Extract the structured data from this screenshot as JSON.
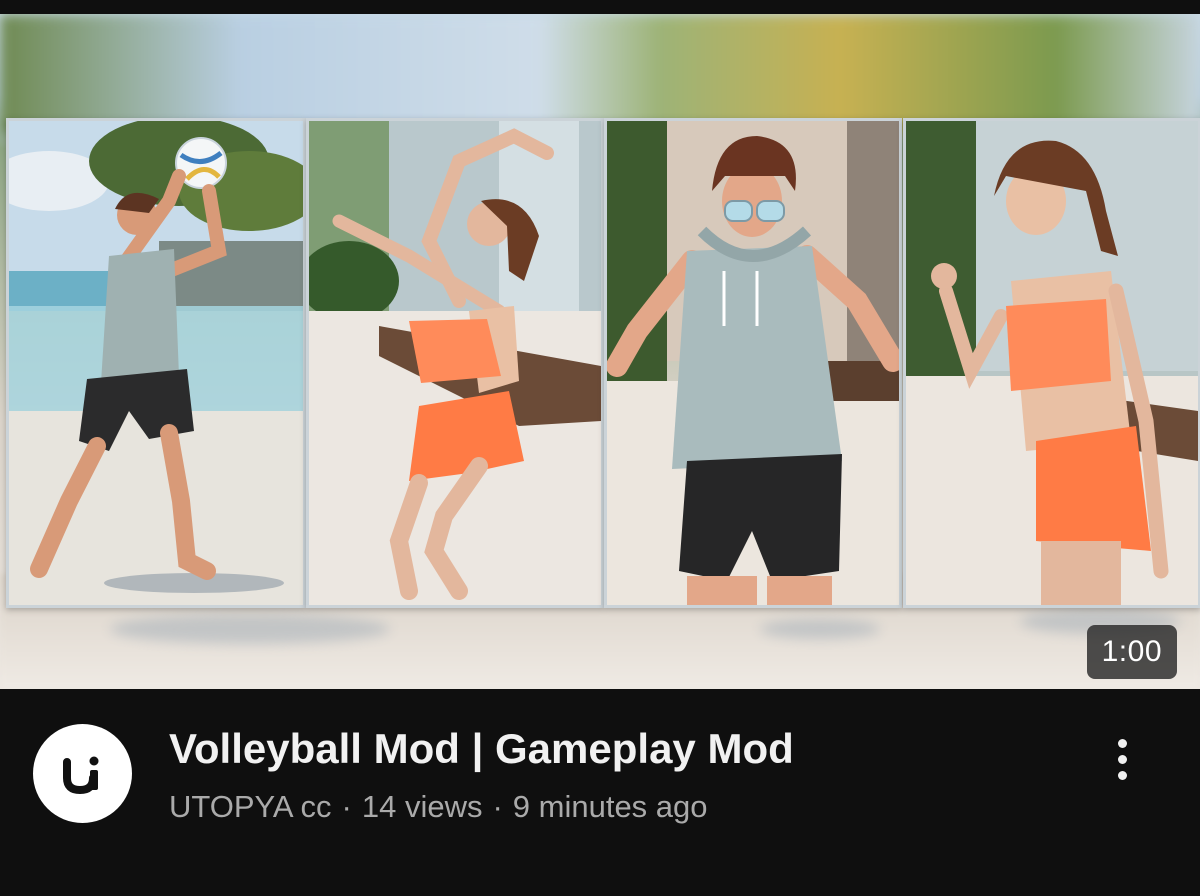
{
  "video": {
    "duration": "1:00",
    "title": "Volleyball Mod | Gameplay Mod",
    "channel": "UTOPYA cc",
    "views": "14 views",
    "age": "9 minutes ago",
    "separator": "·"
  },
  "icons": {
    "avatar": "utopya-logo-icon",
    "menu": "more-vertical-icon"
  },
  "colors": {
    "background": "#0f0f0f",
    "title": "#f1f1f1",
    "subtitle": "#aaaaaa",
    "badge_bg": "#282828"
  }
}
